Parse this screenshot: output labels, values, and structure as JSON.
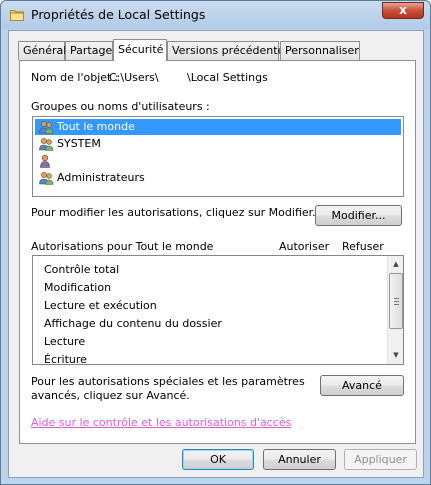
{
  "window": {
    "title": "Propriétés de Local Settings",
    "close_glyph": "x"
  },
  "tabs": [
    {
      "label": "Général"
    },
    {
      "label": "Partage"
    },
    {
      "label": "Sécurité"
    },
    {
      "label": "Versions précédentes"
    },
    {
      "label": "Personnaliser"
    }
  ],
  "security": {
    "object_name_label": "Nom de l'objet :",
    "object_name_prefix": "C:\\Users\\",
    "object_name_suffix": "\\Local Settings",
    "groups_label": "Groupes ou noms d'utilisateurs :",
    "groups": [
      {
        "name": "Tout le monde",
        "icon": "users-group-icon",
        "selected": true
      },
      {
        "name": "SYSTEM",
        "icon": "users-group-icon",
        "selected": false
      },
      {
        "name": "",
        "icon": "user-icon",
        "selected": false
      },
      {
        "name": "Administrateurs",
        "icon": "users-group-icon",
        "selected": false
      }
    ],
    "modify_hint": "Pour modifier les autorisations, cliquez sur Modifier.",
    "modify_button": "Modifier...",
    "permissions_label": "Autorisations pour Tout le monde",
    "allow_header": "Autoriser",
    "deny_header": "Refuser",
    "permissions": [
      "Contrôle total",
      "Modification",
      "Lecture et exécution",
      "Affichage du contenu du dossier",
      "Lecture",
      "Écriture"
    ],
    "advanced_hint_line1": "Pour les autorisations spéciales et les paramètres",
    "advanced_hint_line2": "avancés, cliquez sur Avancé.",
    "advanced_button": "Avancé",
    "help_link": "Aide sur le contrôle et les autorisations d'accès"
  },
  "footer": {
    "ok": "OK",
    "cancel": "Annuler",
    "apply": "Appliquer"
  },
  "colors": {
    "selection": "#3399ff",
    "link": "#e05cd8",
    "title_bar": "#bcd3ea",
    "close_button": "#c7503a"
  }
}
